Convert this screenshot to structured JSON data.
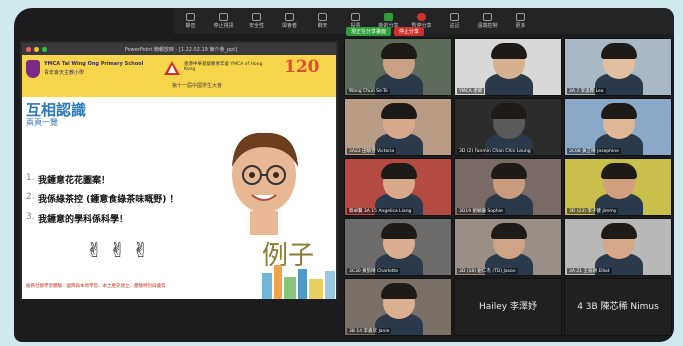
{
  "toolbar": {
    "buttons": [
      {
        "label": "靜音",
        "icon": "mic-icon"
      },
      {
        "label": "停止視訊",
        "icon": "camera-icon"
      },
      {
        "label": "安全性",
        "icon": "shield-icon"
      },
      {
        "label": "與會者",
        "icon": "participants-icon"
      },
      {
        "label": "聊天",
        "icon": "chat-icon"
      },
      {
        "label": "投票",
        "icon": "poll-icon"
      },
      {
        "label": "新的分享",
        "icon": "share-icon"
      },
      {
        "label": "暫停分享",
        "icon": "pause-icon"
      },
      {
        "label": "註記",
        "icon": "annotate-icon"
      },
      {
        "label": "遠端控制",
        "icon": "remote-icon"
      },
      {
        "label": "更多",
        "icon": "more-icon"
      }
    ]
  },
  "share_banner": {
    "viewing": "現正在分享畫面",
    "stop": "停止分享"
  },
  "ppt_window": {
    "title": "PowerPoint 簡報放映 - [1.22.02.19 簡介會_ppt]",
    "slide": {
      "school_en": "YMCA Tai Wing Ong Primary School",
      "school_zh": "青年會天主教小學",
      "ymca_name": "香港中華基督教青年會 YMCA of Hong Kong",
      "anniversary": "120",
      "event": "第十一屆中國學生大會",
      "title": "互相認識",
      "subtitle": "兩頁一覽",
      "lines": [
        {
          "n": "1.",
          "text": "我鍾意花花圖案！"
        },
        {
          "n": "2.",
          "text": "我係綠茶控 (鍾意食綠茶味嘅野) ！"
        },
        {
          "n": "3.",
          "text": "我鍾意的學科係科學！"
        }
      ],
      "hands": "✌ ✌ ✌",
      "example": "例子",
      "footer": "服務社群學習體驗、國際與本地學習、本土歷史建立、體驗特別與優質"
    }
  },
  "gallery": [
    {
      "name": "Wang Chun Se-Te",
      "bg": "#5c6b5a",
      "face": "#c9a184"
    },
    {
      "name": "YMCA 老師",
      "bg": "#d8d8d8",
      "face": "#d8b08e"
    },
    {
      "name": "3A 7 李浚霖 Leo",
      "bg": "#a8b8c4",
      "face": "#e2bfa0"
    },
    {
      "name": "3A23 田曉雪 Victoria",
      "bg": "#b89c86",
      "face": "#d8a98a"
    },
    {
      "name": "3D (2) Fanmin Chan Chin Leung",
      "bg": "#2c2c2c",
      "face": "#5a5a5a"
    },
    {
      "name": "3C08 黃芷晴 Josephine",
      "bg": "#8aa8c8",
      "face": "#e0b896"
    },
    {
      "name": "蔡卓賢 3A 15 Angelica Liang",
      "bg": "#b44a40",
      "face": "#d9a98a"
    },
    {
      "name": "3D19 劉穎謙 Sophie",
      "bg": "#7a6a66",
      "face": "#c99a7c"
    },
    {
      "name": "3D (23) 李子健 Jimmy",
      "bg": "#c8c04a",
      "face": "#d0a07e"
    },
    {
      "name": "3C30 黃凱晴 Charlotte",
      "bg": "#6d6b6a",
      "face": "#dcae90"
    },
    {
      "name": "3D (18) 劉仁杰 (TD) Jason",
      "bg": "#9a8f86",
      "face": "#cfa486"
    },
    {
      "name": "3A 21 王晉朗 Elliot",
      "bg": "#b8b8b8",
      "face": "#d6a88a"
    },
    {
      "name": "3B 14 李嘉欣 Janie",
      "bg": "#7a7066",
      "face": "#ddb092"
    },
    {
      "name": "Hailey 李澤妤",
      "bg": "#202020",
      "face": ""
    },
    {
      "name": "4 3B 陳芯稀 Nimus",
      "bg": "#202020",
      "face": ""
    }
  ]
}
